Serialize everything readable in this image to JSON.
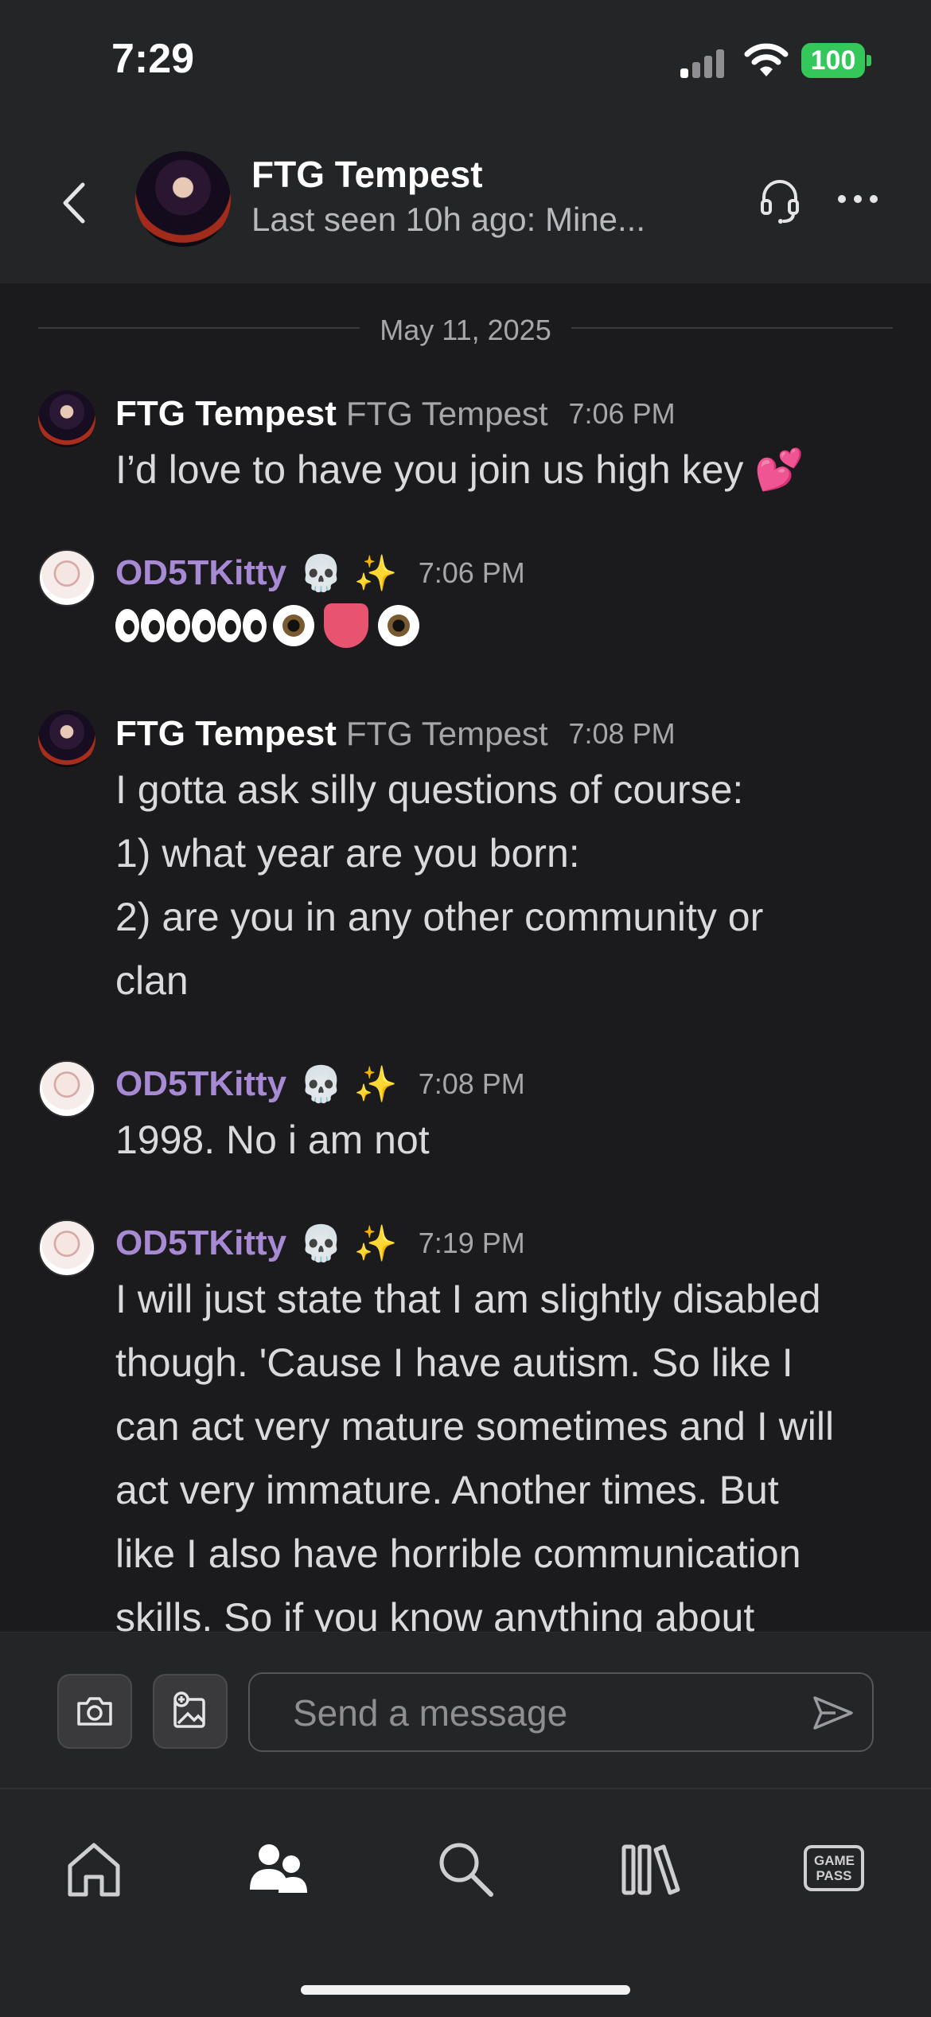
{
  "status_bar": {
    "time": "7:29",
    "battery": "100"
  },
  "header": {
    "name": "FTG Tempest",
    "status": "Last seen 10h ago: Mine..."
  },
  "chat": {
    "date": "May 11, 2025",
    "messages": [
      {
        "sender": "FTG Tempest",
        "sub": "FTG Tempest",
        "time": "7:06 PM",
        "text": "I’d love to have you join us high key 💕"
      },
      {
        "sender": "OD5TKitty",
        "badges": "💀 ✨",
        "time": "7:06 PM",
        "text": "👀👀👀👁️👅👁️"
      },
      {
        "sender": "FTG Tempest",
        "sub": "FTG Tempest",
        "time": "7:08 PM",
        "lines": [
          "I gotta ask silly questions of course:",
          "1) what year are you born:",
          "2) are you in any other community or",
          "clan"
        ]
      },
      {
        "sender": "OD5TKitty",
        "badges": "💀 ✨",
        "time": "7:08 PM",
        "text": "1998. No i am not"
      },
      {
        "sender": "OD5TKitty",
        "badges": "💀 ✨",
        "time": "7:19 PM",
        "lines": [
          "I will just state that I am slightly disabled",
          "though. 'Cause I have autism. So like I",
          "can act very mature sometimes and I will",
          "act very immature. Another times. But",
          "like I also have horrible communication",
          "skills. So if you know anything about"
        ]
      }
    ]
  },
  "composer": {
    "placeholder": "Send a message"
  },
  "tabs": [
    {
      "icon": "home-icon",
      "active": false
    },
    {
      "icon": "friends-icon",
      "active": true
    },
    {
      "icon": "search-icon",
      "active": false
    },
    {
      "icon": "library-icon",
      "active": false
    },
    {
      "icon": "game-pass-icon",
      "active": false,
      "label": "GAME PASS"
    }
  ],
  "colors": {
    "accent_name": "#a88ad4",
    "battery": "#34c759",
    "background": "#1b1b1d",
    "surface": "#242527"
  }
}
